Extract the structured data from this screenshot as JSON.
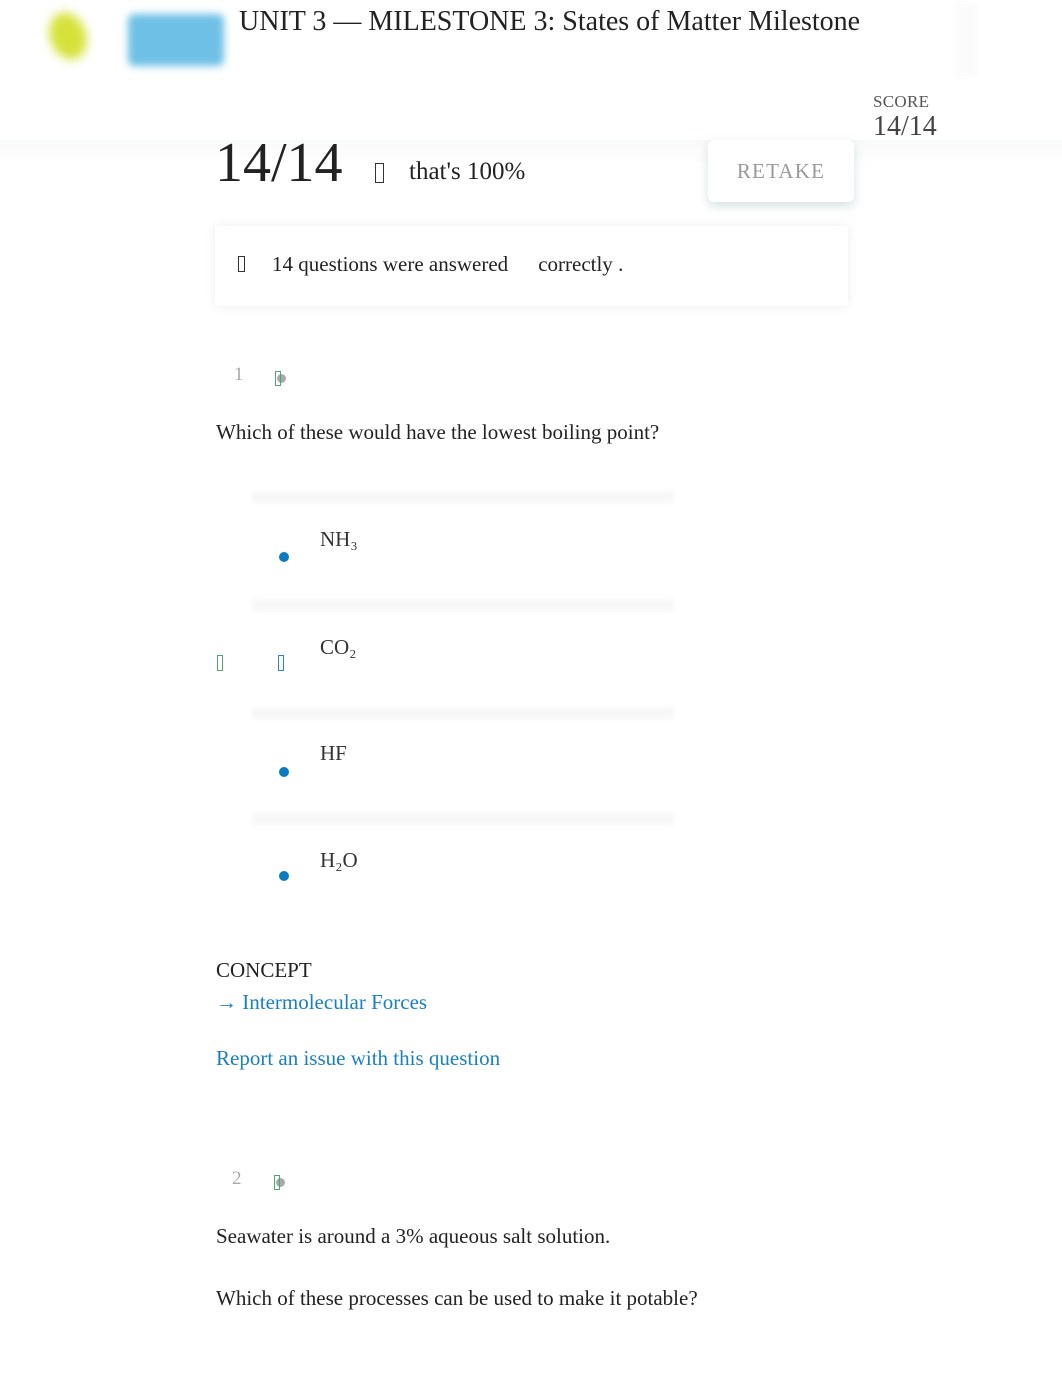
{
  "header": {
    "title": "UNIT 3 — MILESTONE 3: States of Matter Milestone",
    "logo_icon": "brand-logo-icon",
    "brand_icon": "brand-badge-icon"
  },
  "score": {
    "label": "SCORE",
    "value": "14/14",
    "big_value": "14/14",
    "percent_text": "that's 100%",
    "percent_icon": "thumbs-up-icon",
    "retake_label": "RETAKE"
  },
  "summary": {
    "icon": "check-icon",
    "text_part1": "14 questions were answered",
    "text_part2": "correctly",
    "text_end": "."
  },
  "colors": {
    "accent_blue": "#0a7bc2",
    "link_blue": "#1a7fc1",
    "correct_green": "#4aa874",
    "muted_gray": "#aaaaaa"
  },
  "questions": [
    {
      "number": "1",
      "status_icon": "correct-status-icon",
      "text": "Which of these would have the lowest boiling point?",
      "choices": [
        {
          "label": "NH₃",
          "selected": false,
          "correct": false
        },
        {
          "label": "CO₂",
          "selected": true,
          "correct": true
        },
        {
          "label": "HF",
          "selected": false,
          "correct": false
        },
        {
          "label": "H₂O",
          "selected": false,
          "correct": false
        }
      ],
      "concept_label": "CONCEPT",
      "concept_link": "→ Intermolecular Forces",
      "report_link": "Report an issue with this question"
    },
    {
      "number": "2",
      "status_icon": "correct-status-icon",
      "text_line1": "Seawater is around a 3% aqueous salt solution.",
      "text_line2": "Which of these processes can be used to make it potable?"
    }
  ]
}
